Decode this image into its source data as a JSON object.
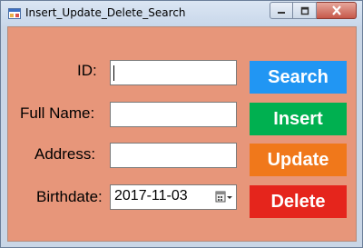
{
  "window": {
    "title": "Insert_Update_Delete_Search",
    "controls": [
      "minimize",
      "maximize",
      "close"
    ]
  },
  "form": {
    "id_label": "ID:",
    "id_value": "",
    "fullname_label": "Full Name:",
    "fullname_value": "",
    "address_label": "Address:",
    "address_value": "",
    "birthdate_label": "Birthdate:",
    "birthdate_value": "2017-11-03"
  },
  "buttons": {
    "search": {
      "label": "Search",
      "color": "#2196f3"
    },
    "insert": {
      "label": "Insert",
      "color": "#00b050"
    },
    "update": {
      "label": "Update",
      "color": "#f0781b"
    },
    "delete": {
      "label": "Delete",
      "color": "#e5251c"
    }
  },
  "colors": {
    "client_background": "#e7967a",
    "titlebar": "#c8d7ea"
  },
  "icons": {
    "app": "app-icon",
    "minimize": "minimize-icon",
    "maximize": "maximize-icon",
    "close": "close-icon",
    "calendar": "calendar-dropdown-icon"
  }
}
